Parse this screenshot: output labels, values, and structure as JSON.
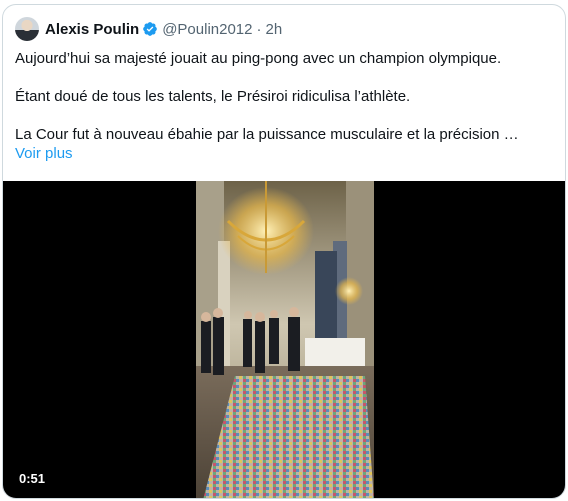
{
  "tweet": {
    "author_name": "Alexis Poulin",
    "handle": "@Poulin2012",
    "separator": "·",
    "time": "2h",
    "paragraphs": [
      "Aujourd’hui sa majesté jouait au ping-pong avec un champion olympique.",
      "Étant doué de tous les talents, le Présiroi ridiculisa l’athlète.",
      "La Cour fut à nouveau ébahie par la puissance musculaire et la précision …"
    ],
    "show_more": "Voir plus"
  },
  "video": {
    "duration": "0:51"
  },
  "colors": {
    "link": "#1d9bf0",
    "verified_badge": "#1d9bf0",
    "secondary_text": "#536471"
  },
  "icons": {
    "verified": "verified-badge-icon",
    "avatar": "profile-avatar"
  }
}
